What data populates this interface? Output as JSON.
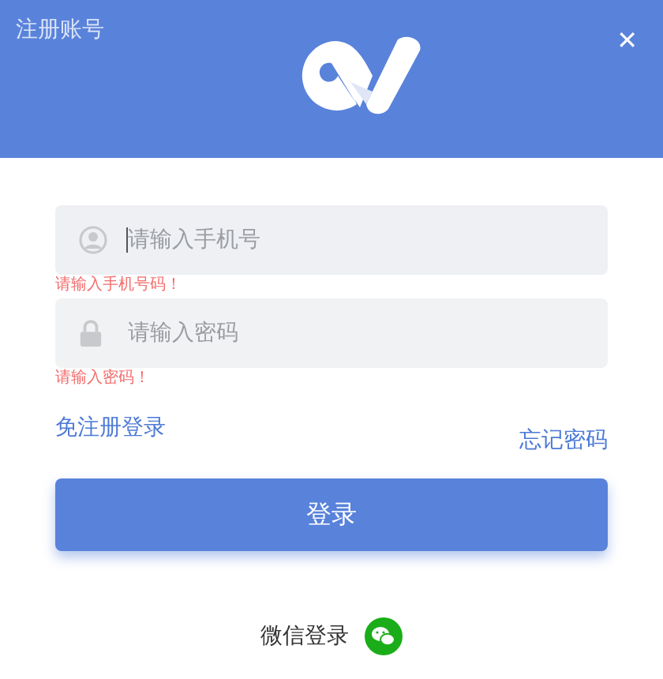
{
  "header": {
    "register_link": "注册账号",
    "close": "✕"
  },
  "fields": [
    {
      "kind": "phone",
      "placeholder": "请输入手机号",
      "error": "请输入手机号码！",
      "focused": true
    },
    {
      "kind": "password",
      "placeholder": "请输入密码",
      "error": "请输入密码！",
      "focused": false
    }
  ],
  "links": {
    "sms_login": "免注册登录",
    "forgot_password": "忘记密码"
  },
  "login_button": "登录",
  "wechat_login": "微信登录"
}
